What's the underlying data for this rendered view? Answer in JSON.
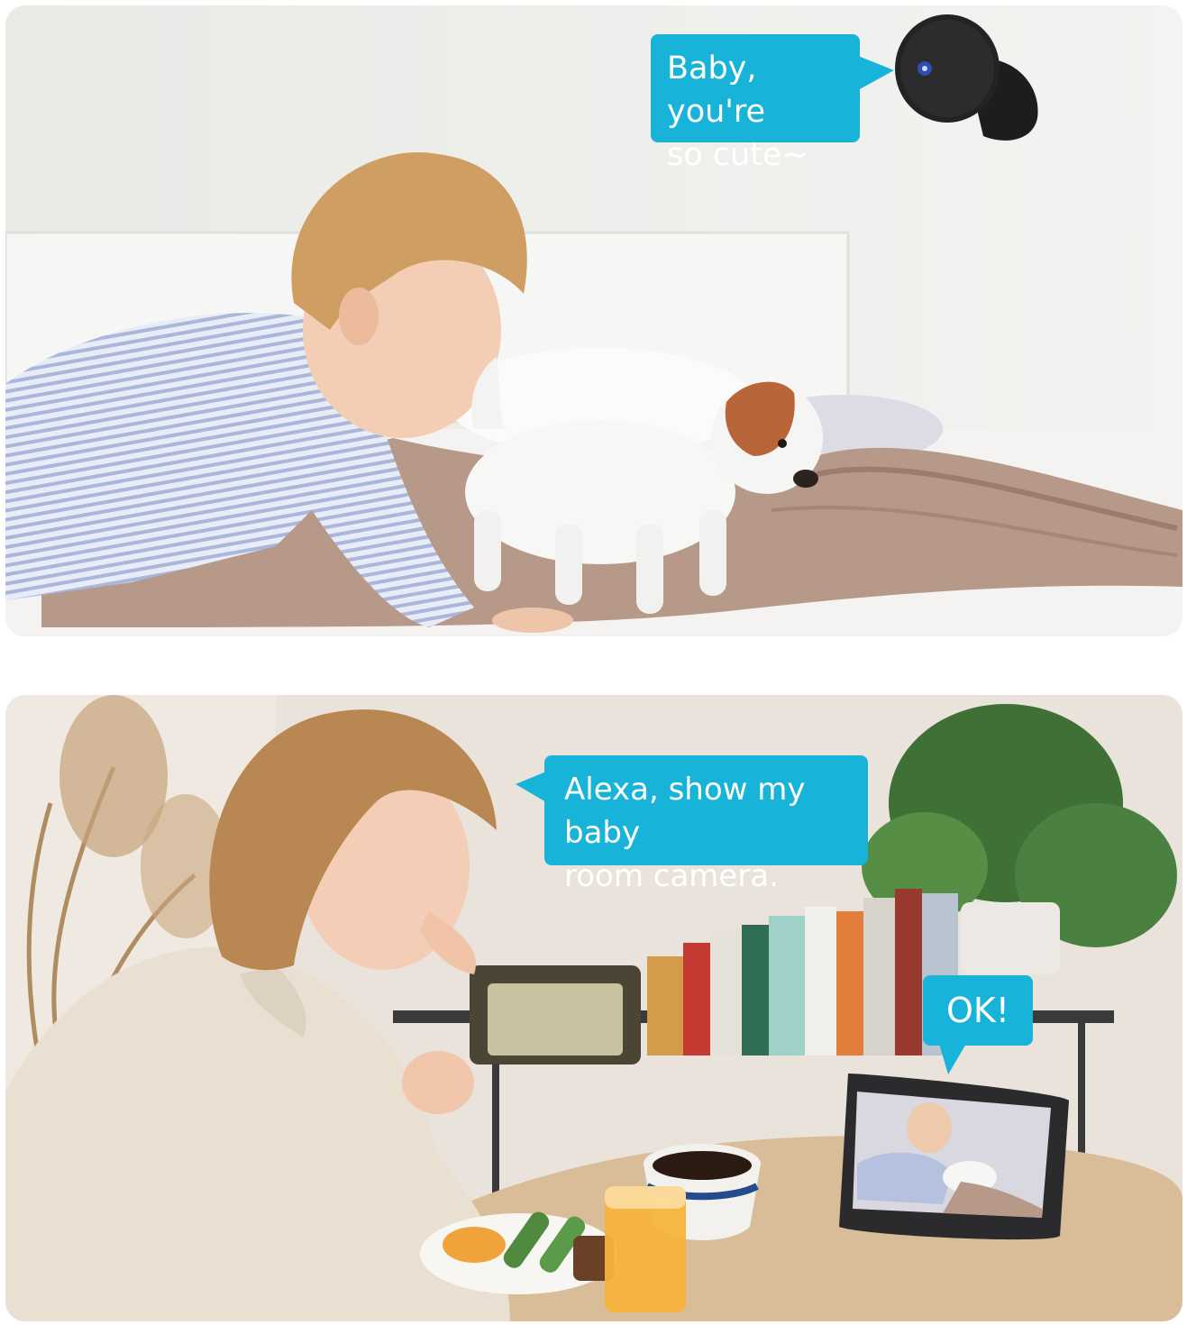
{
  "top_scene": {
    "speech_bubble": {
      "lines": [
        "Baby, you're",
        "so cute~"
      ]
    },
    "camera_icon": "wall-mounted-security-camera-icon",
    "scene_icons": [
      "child-icon",
      "puppy-icon",
      "bed-icon"
    ]
  },
  "bottom_scene": {
    "speech_bubble_user": {
      "lines": [
        "Alexa, show my baby",
        "room camera."
      ]
    },
    "speech_bubble_device": {
      "lines": [
        "OK!"
      ]
    },
    "device_icon": "smart-display-icon",
    "scene_icons": [
      "woman-icon",
      "table-icon",
      "coffee-cup-icon",
      "juice-glass-icon",
      "bookshelf-icon",
      "plant-icon"
    ]
  },
  "colors": {
    "bubble": "#18b3d8",
    "bubble_text": "#ffffff"
  }
}
